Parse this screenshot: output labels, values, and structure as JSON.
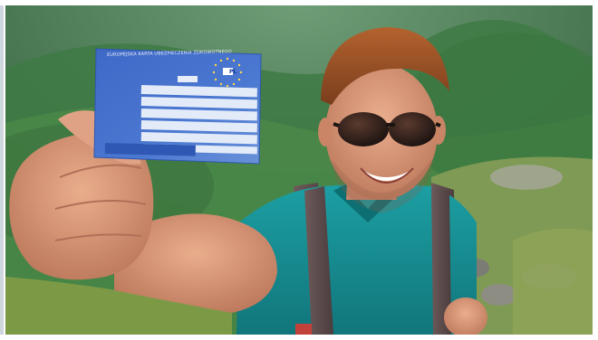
{
  "image": {
    "card_header": "EUROPEJSKA KARTA UBEZPIECZENIA ZDROWOTNEGO",
    "card_country_code": "PL"
  }
}
